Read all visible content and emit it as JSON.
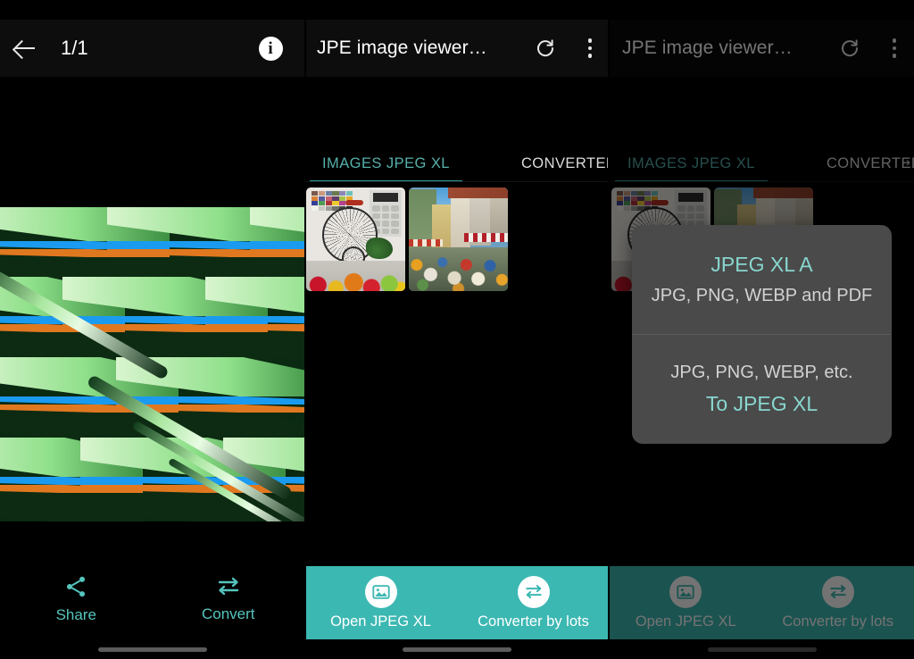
{
  "app": {
    "left_panel": {
      "appbar": {
        "back_icon": "back-arrow-icon",
        "counter": "1/1",
        "info_icon": "info-icon"
      },
      "artwork_alt": "abstract green blue orange chevron pattern",
      "actions": [
        {
          "label": "Share",
          "icon": "share-icon"
        },
        {
          "label": "Convert",
          "icon": "swap-arrows-icon"
        }
      ]
    },
    "middle_panel": {
      "appbar": {
        "title": "JPE image viewer…",
        "reload_icon": "reload-icon",
        "overflow_icon": "more-vertical-icon"
      },
      "tabs": [
        {
          "label": "IMAGES JPEG XL",
          "active": true
        },
        {
          "label": "CONVERTED",
          "active": false
        }
      ],
      "thumbnails": [
        {
          "alt": "color chart penny-farthing bicycle and fruit still life"
        },
        {
          "alt": "european street cafe crowd scene"
        }
      ],
      "bottom_bar": {
        "color": "#3cb8b2",
        "actions": [
          {
            "label": "Open JPEG XL",
            "icon": "image-icon"
          },
          {
            "label": "Converter by lots",
            "icon": "swap-arrows-icon"
          }
        ]
      }
    },
    "right_panel": {
      "appbar": {
        "title": "JPE image viewer…",
        "reload_icon": "reload-icon",
        "overflow_icon": "more-vertical-icon"
      },
      "tabs": [
        {
          "label": "IMAGES JPEG XL",
          "active": true
        },
        {
          "label": "CONVERTED",
          "active": false
        },
        {
          "label": "›",
          "active": false
        }
      ],
      "bottom_bar": {
        "actions": [
          {
            "label": "Open JPEG XL",
            "icon": "image-icon"
          },
          {
            "label": "Converter by lots",
            "icon": "swap-arrows-icon"
          }
        ]
      },
      "dialog": {
        "items": [
          {
            "title": "JPEG XL A",
            "subtitle": "JPG, PNG, WEBP and PDF"
          },
          {
            "subtitle": "JPG, PNG, WEBP, etc.",
            "title": "To JPEG XL"
          }
        ]
      }
    },
    "colors": {
      "accent_teal": "#3cb8b2",
      "tab_active": "#56b0aa",
      "dialog_bg": "#4a4a4a",
      "dialog_accent": "#88d6cf"
    }
  }
}
